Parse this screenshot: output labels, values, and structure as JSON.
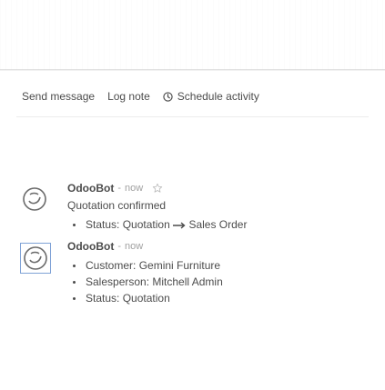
{
  "chatter": {
    "send_message": "Send message",
    "log_note": "Log note",
    "schedule_activity": "Schedule activity"
  },
  "messages": [
    {
      "author": "OdooBot",
      "separator": "-",
      "time": "now",
      "body": "Quotation confirmed",
      "tracking": [
        {
          "label": "Status:",
          "old": "Quotation",
          "new": "Sales Order"
        }
      ]
    },
    {
      "author": "OdooBot",
      "separator": "-",
      "time": "now",
      "tracking": [
        {
          "label": "Customer:",
          "value": "Gemini Furniture"
        },
        {
          "label": "Salesperson:",
          "value": "Mitchell Admin"
        },
        {
          "label": "Status:",
          "value": "Quotation"
        }
      ]
    }
  ],
  "icons": {
    "clock": "clock-icon",
    "star": "star-icon",
    "arrow": "long-arrow-right-icon",
    "avatar": "odoobot-avatar"
  }
}
